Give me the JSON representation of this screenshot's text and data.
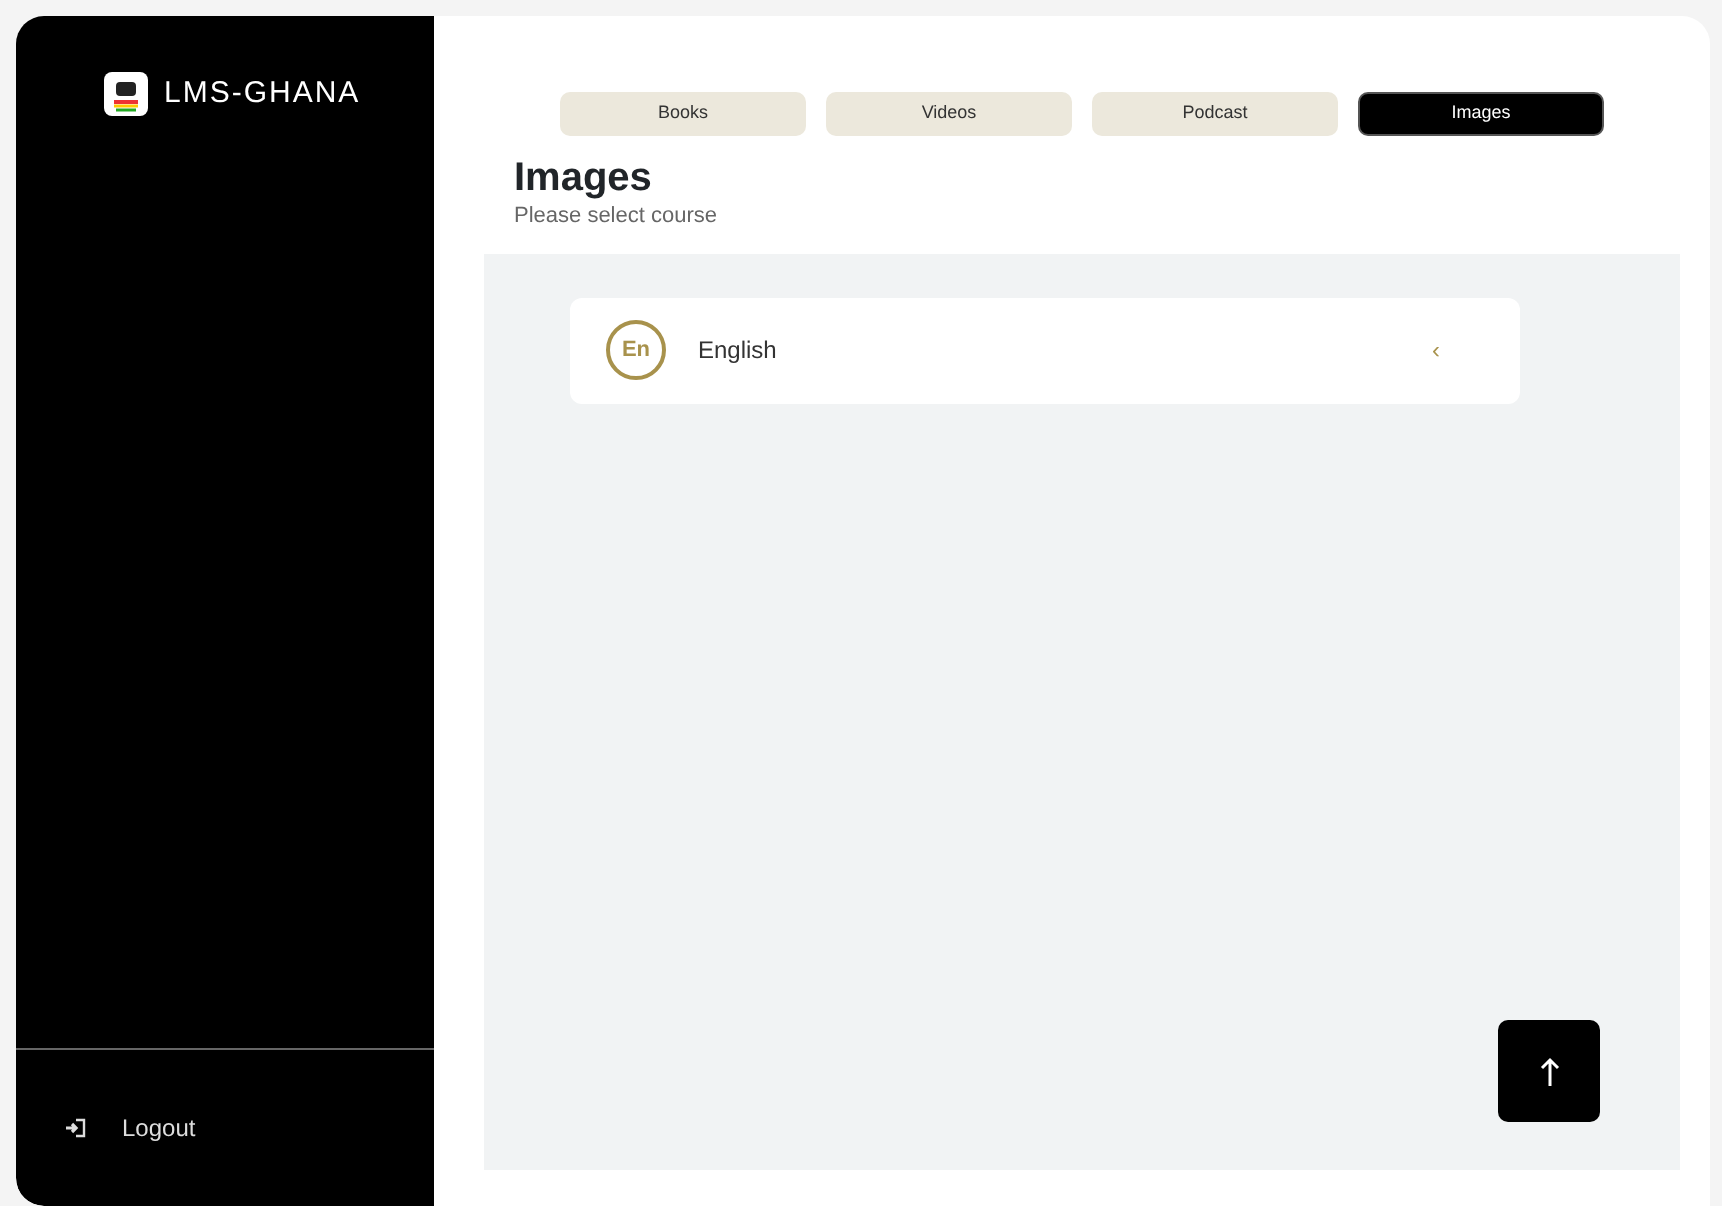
{
  "sidebar": {
    "brand": "LMS-GHANA",
    "logout": "Logout"
  },
  "tabs": [
    {
      "label": "Books",
      "selected": false
    },
    {
      "label": "Videos",
      "selected": false
    },
    {
      "label": "Podcast",
      "selected": false
    },
    {
      "label": "Images",
      "selected": true
    }
  ],
  "page": {
    "title": "Images",
    "subtitle": "Please select course"
  },
  "courses": [
    {
      "abbr": "En",
      "name": "English",
      "chevron": "‹"
    }
  ]
}
